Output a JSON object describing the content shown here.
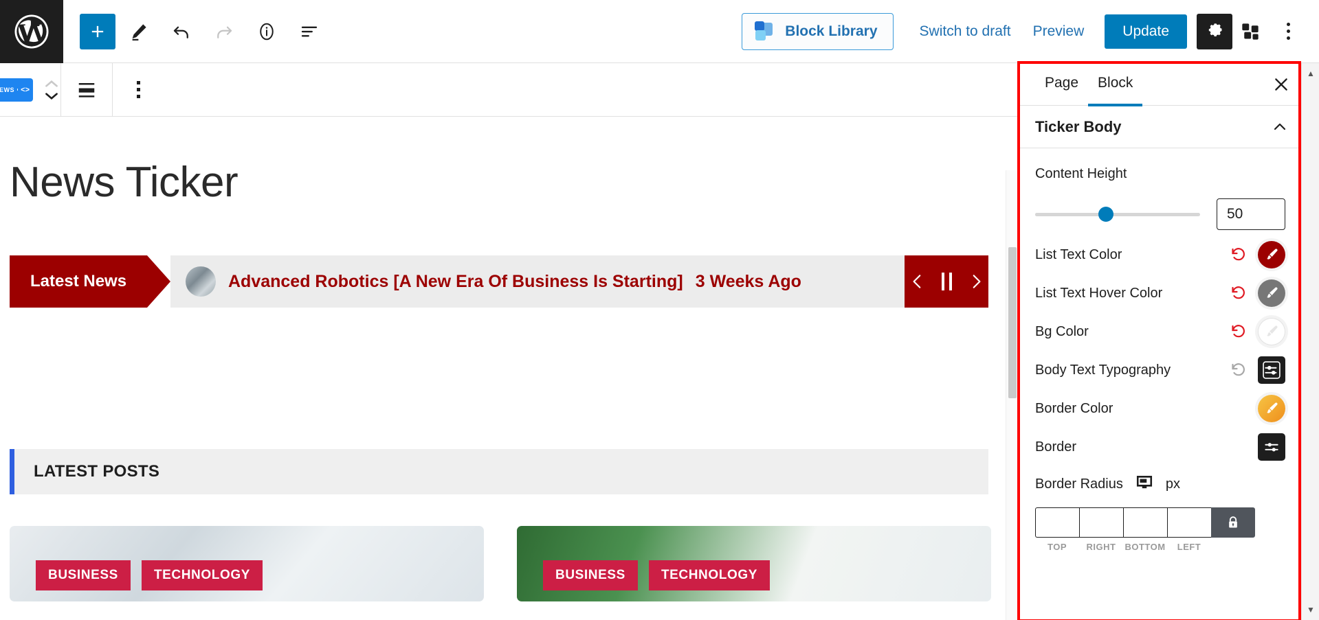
{
  "toolbar": {
    "logo_icon": "wordpress-logo-icon",
    "add_label": "+",
    "block_library_label": "Block Library",
    "switch_to_draft_label": "Switch to draft",
    "preview_label": "Preview",
    "update_label": "Update",
    "icons": {
      "add": "plus-icon",
      "edit": "pencil-icon",
      "undo": "undo-icon",
      "redo": "redo-icon",
      "info": "info-icon",
      "outline": "list-view-icon",
      "settings": "gear-icon",
      "blocks": "blocks-icon",
      "more": "kebab-menu-icon"
    },
    "accent_blue": "#007cba",
    "link_blue": "#2271b1"
  },
  "block_toolbar": {
    "block_icon_label": "NEWS",
    "icons": {
      "block": "news-ticker-block-icon",
      "move_up": "chevron-up-icon",
      "move_down": "chevron-down-icon",
      "align": "align-icon",
      "options": "kebab-menu-icon"
    }
  },
  "canvas": {
    "page_title": "News Ticker",
    "ticker": {
      "label": "Latest News",
      "headline": "Advanced Robotics [A New Era Of Business Is Starting]",
      "time": "3 Weeks Ago",
      "label_bg": "#9c0000",
      "body_bg": "#ececec",
      "text_color": "#9c0000",
      "controls": {
        "prev": "chevron-left-icon",
        "pause": "pause-icon",
        "next": "chevron-right-icon"
      }
    },
    "latest_posts": {
      "heading": "LATEST POSTS",
      "accent_bar": "#2f5fe0",
      "cards": [
        {
          "tags": [
            "BUSINESS",
            "TECHNOLOGY"
          ]
        },
        {
          "tags": [
            "BUSINESS",
            "TECHNOLOGY"
          ]
        }
      ],
      "tag_color": "#cc1f45"
    }
  },
  "sidebar": {
    "tabs": [
      {
        "label": "Page",
        "active": false
      },
      {
        "label": "Block",
        "active": true
      }
    ],
    "close_icon": "close-icon",
    "section": {
      "title": "Ticker Body",
      "chevron": "chevron-up-icon"
    },
    "content_height": {
      "label": "Content Height",
      "value": "50",
      "slider_percent": 43
    },
    "controls": [
      {
        "label": "List Text Color",
        "reset": true,
        "reset_enabled": true,
        "swatch": "#9c0000",
        "type": "color"
      },
      {
        "label": "List Text Hover Color",
        "reset": true,
        "reset_enabled": true,
        "swatch": "#777777",
        "type": "color"
      },
      {
        "label": "Bg Color",
        "reset": true,
        "reset_enabled": true,
        "swatch": "#ffffff",
        "type": "color"
      },
      {
        "label": "Body Text Typography",
        "reset": true,
        "reset_enabled": false,
        "swatch": null,
        "type": "typography"
      },
      {
        "label": "Border Color",
        "reset": false,
        "reset_enabled": false,
        "swatch": "#f0a61e",
        "type": "color"
      },
      {
        "label": "Border",
        "reset": false,
        "reset_enabled": false,
        "swatch": null,
        "type": "settings"
      }
    ],
    "border_radius": {
      "label": "Border Radius",
      "device_icon": "desktop-icon",
      "unit": "px",
      "inputs": [
        {
          "label": "TOP",
          "value": ""
        },
        {
          "label": "RIGHT",
          "value": ""
        },
        {
          "label": "BOTTOM",
          "value": ""
        },
        {
          "label": "LEFT",
          "value": ""
        }
      ],
      "lock_icon": "lock-icon"
    },
    "highlight_color": "#fe0000"
  }
}
